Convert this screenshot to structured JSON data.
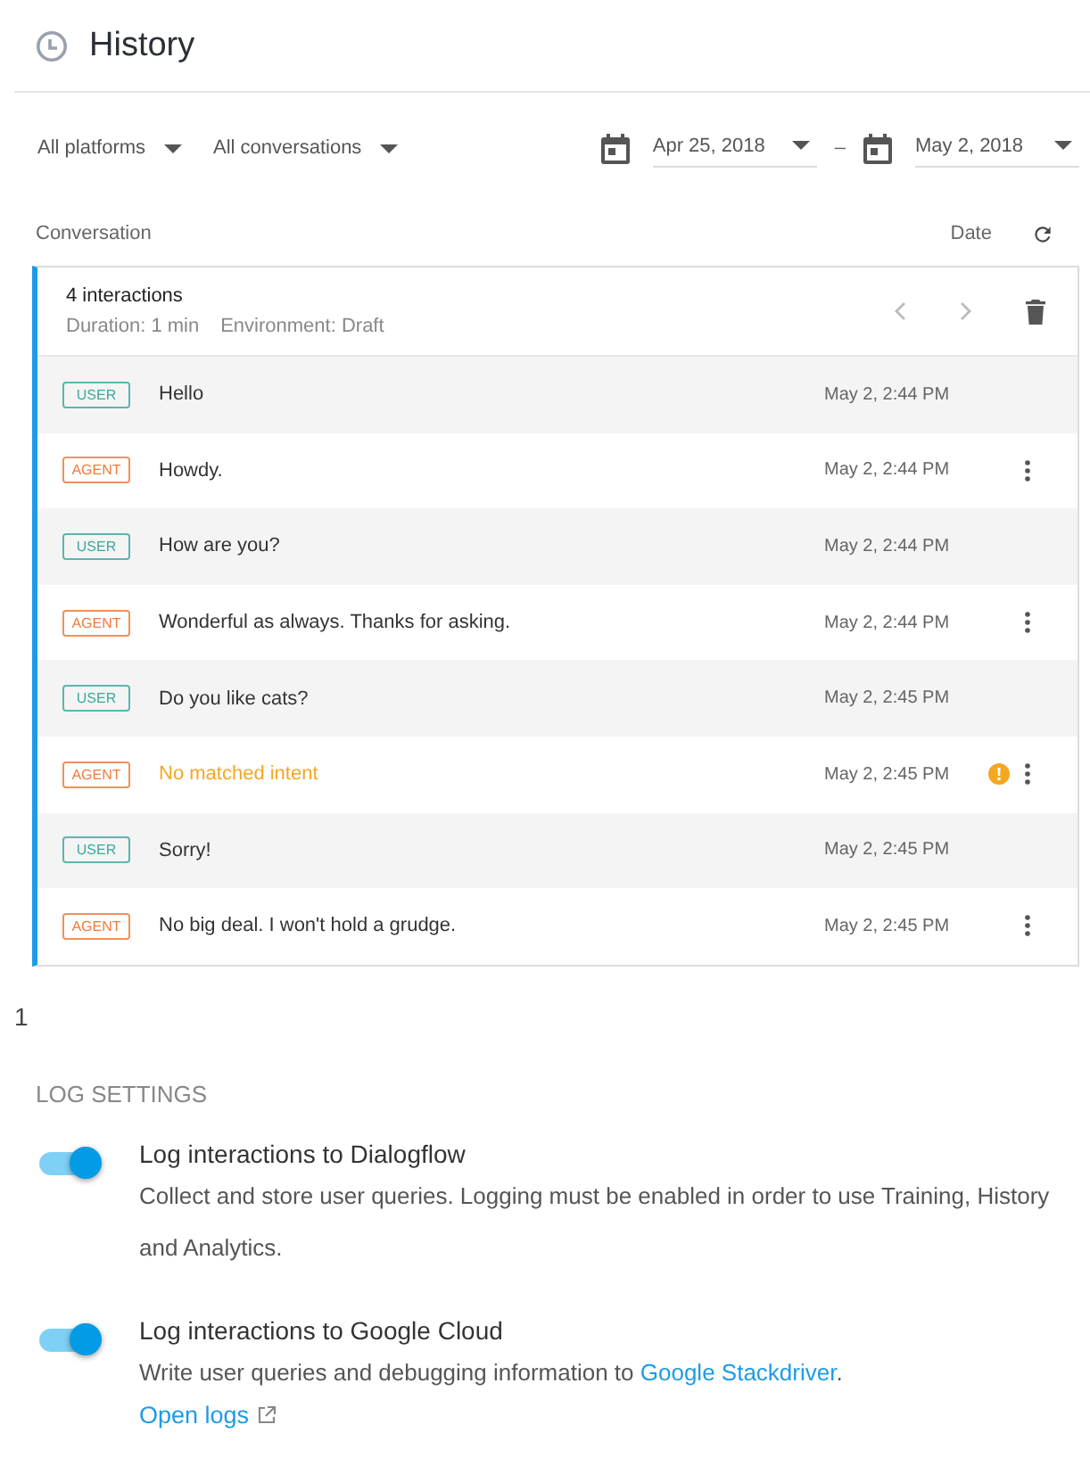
{
  "header": {
    "title": "History"
  },
  "filters": {
    "platform": "All platforms",
    "conversation_type": "All conversations",
    "date_from": "Apr 25, 2018",
    "date_separator": "–",
    "date_to": "May 2, 2018"
  },
  "table": {
    "columns": [
      "Conversation",
      "Date"
    ]
  },
  "conversation": {
    "title": "4 interactions",
    "duration": "Duration: 1 min",
    "environment": "Environment: Draft",
    "messages": [
      {
        "kind": "user",
        "role": "USER",
        "text": "Hello",
        "time": "May 2, 2:44 PM",
        "warning": false,
        "menu": false
      },
      {
        "kind": "agent",
        "role": "AGENT",
        "text": "Howdy.",
        "time": "May 2, 2:44 PM",
        "warning": false,
        "menu": true
      },
      {
        "kind": "user",
        "role": "USER",
        "text": "How are you?",
        "time": "May 2, 2:44 PM",
        "warning": false,
        "menu": false
      },
      {
        "kind": "agent",
        "role": "AGENT",
        "text": "Wonderful as always. Thanks for asking.",
        "time": "May 2, 2:44 PM",
        "warning": false,
        "menu": true
      },
      {
        "kind": "user",
        "role": "USER",
        "text": "Do you like cats?",
        "time": "May 2, 2:45 PM",
        "warning": false,
        "menu": false
      },
      {
        "kind": "agent",
        "role": "AGENT",
        "text": "No matched intent",
        "time": "May 2, 2:45 PM",
        "warning": true,
        "menu": true
      },
      {
        "kind": "user",
        "role": "USER",
        "text": "Sorry!",
        "time": "May 2, 2:45 PM",
        "warning": false,
        "menu": false
      },
      {
        "kind": "agent",
        "role": "AGENT",
        "text": "No big deal. I won't hold a grudge.",
        "time": "May 2, 2:45 PM",
        "warning": false,
        "menu": true
      }
    ]
  },
  "stray_text": "1",
  "log_settings": {
    "heading": "LOG SETTINGS",
    "items": [
      {
        "title": "Log interactions to Dialogflow",
        "on": true,
        "description": "Collect and store user queries. Logging must be enabled in order to use Training, History and Analytics."
      },
      {
        "title": "Log interactions to Google Cloud",
        "on": true,
        "description": "Write user queries and debugging information to ",
        "link": "Google Stackdriver",
        "description_end": ".",
        "extra_link": "Open logs"
      }
    ]
  }
}
